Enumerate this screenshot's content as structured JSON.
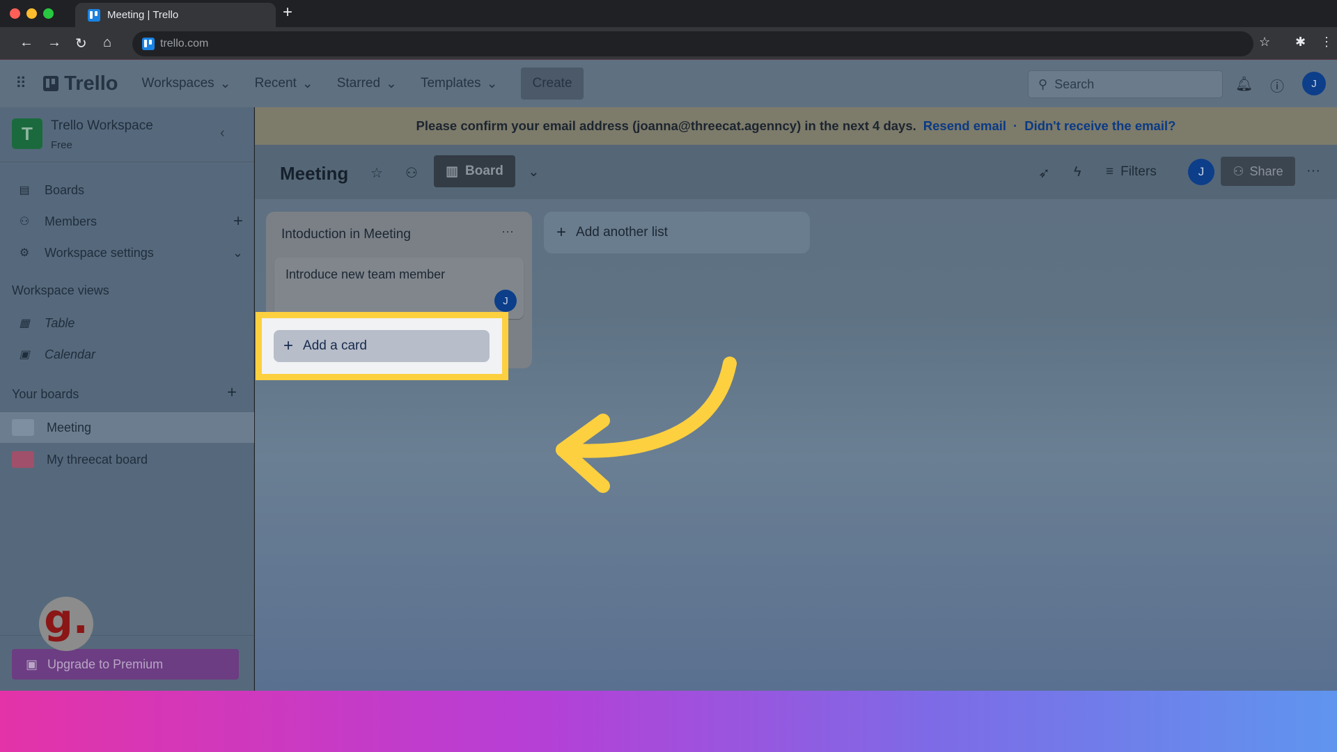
{
  "browser": {
    "tab_title": "Meeting | Trello",
    "url": "trello.com"
  },
  "header": {
    "logo": "Trello",
    "nav": [
      {
        "label": "Workspaces"
      },
      {
        "label": "Recent"
      },
      {
        "label": "Starred"
      },
      {
        "label": "Templates"
      }
    ],
    "create": "Create",
    "search_placeholder": "Search",
    "avatar": "J"
  },
  "sidebar": {
    "workspace_initial": "T",
    "workspace_name": "Trello Workspace",
    "plan": "Free",
    "items": [
      {
        "label": "Boards",
        "icon": "board-icon"
      },
      {
        "label": "Members",
        "icon": "person-icon"
      },
      {
        "label": "Workspace settings",
        "icon": "gear-icon"
      }
    ],
    "views_heading": "Workspace views",
    "views": [
      {
        "label": "Table"
      },
      {
        "label": "Calendar"
      }
    ],
    "boards_heading": "Your boards",
    "boards": [
      {
        "label": "Meeting",
        "color": "#7d8fa0"
      },
      {
        "label": "My threecat board",
        "color": "#a0506a"
      }
    ],
    "upgrade": "Upgrade to Premium",
    "brand_logo": "g."
  },
  "banner": {
    "text": "Please confirm your email address (joanna@threecat.agenncy) in the next 4 days.",
    "resend": "Resend email",
    "sep": "·",
    "not_received": "Didn't receive the email?"
  },
  "board": {
    "title": "Meeting",
    "view": "Board",
    "filters": "Filters",
    "avatar": "J",
    "share": "Share"
  },
  "lists": [
    {
      "title": "Intoduction in Meeting",
      "cards": [
        {
          "title": "Introduce new team member",
          "member": "J"
        }
      ],
      "add_card": "Add a card"
    }
  ],
  "add_list": "Add another list",
  "colors": {
    "highlight": "#fdd03f",
    "accent": "#0c66e4"
  }
}
